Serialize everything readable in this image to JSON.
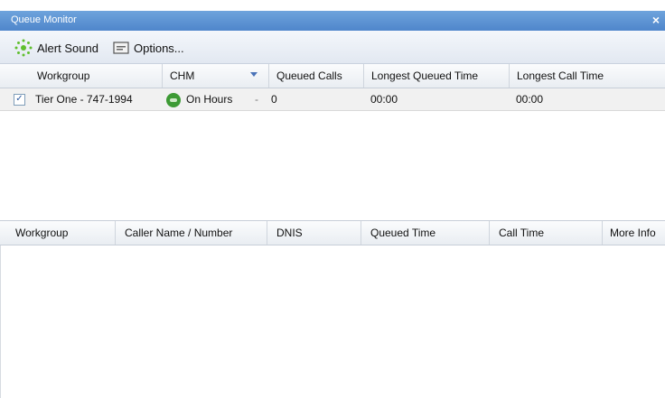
{
  "window": {
    "title": "Queue Monitor",
    "close_label": "×"
  },
  "toolbar": {
    "alert_sound_label": "Alert Sound",
    "options_label": "Options..."
  },
  "top_table": {
    "headers": [
      "Workgroup",
      "CHM",
      "Queued Calls",
      "Longest Queued Time",
      "Longest Call Time"
    ],
    "rows": [
      {
        "checked": true,
        "check_mark": "✓",
        "workgroup": "Tier One - 747-1994",
        "chm": "On Hours",
        "chm_marker": "-",
        "queued_calls": "0",
        "longest_queued_time": "00:00",
        "longest_call_time": "00:00"
      }
    ]
  },
  "bottom_table": {
    "headers": [
      "Workgroup",
      "Caller Name / Number",
      "DNIS",
      "Queued Time",
      "Call Time",
      "More Info"
    ]
  },
  "colors": {
    "titlebar": "#4f86cb",
    "accent": "#4a73b8",
    "status_green": "#3d9a35"
  }
}
